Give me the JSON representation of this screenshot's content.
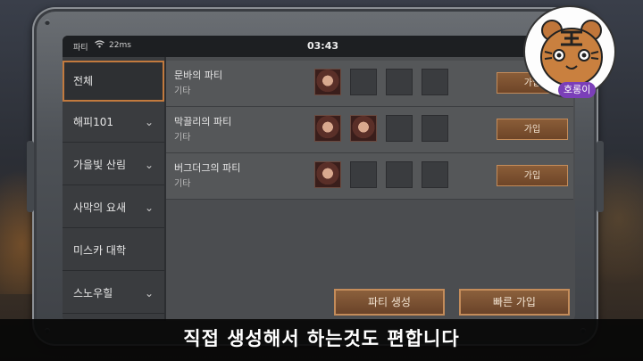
{
  "status": {
    "carrier": "파티",
    "wifi_icon": "wifi-icon",
    "signal": "22ms",
    "time": "03:43"
  },
  "sidebar": {
    "items": [
      {
        "label": "전체",
        "active": true
      },
      {
        "label": "해피101",
        "chevron": true
      },
      {
        "label": "가을빛 산림",
        "chevron": true
      },
      {
        "label": "사막의 요새",
        "chevron": true
      },
      {
        "label": "미스카 대학",
        "chevron": false
      },
      {
        "label": "스노우힐",
        "chevron": true
      }
    ],
    "chevron_glyph": "⌄"
  },
  "parties": [
    {
      "name": "문바의 파티",
      "type": "기타",
      "members": 1,
      "join_label": "가입"
    },
    {
      "name": "막끌리의 파티",
      "type": "기타",
      "members": 2,
      "join_label": "가입"
    },
    {
      "name": "버그더그의 파티",
      "type": "기타",
      "members": 1,
      "join_label": "가입"
    }
  ],
  "actions": {
    "create_label": "파티 생성",
    "quick_join_label": "빠른 가입"
  },
  "badge": {
    "label": "호롱이",
    "icon": "tiger-mascot-icon"
  },
  "caption": "직접 생성해서 하는것도 편합니다",
  "colors": {
    "accent": "#c27a3e",
    "button": "#7a5030",
    "badge_label": "#7b3fb8"
  }
}
